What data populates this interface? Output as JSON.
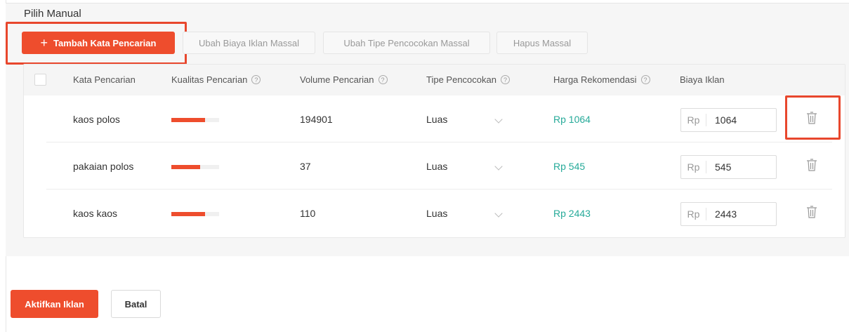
{
  "section": {
    "title": "Pilih Manual"
  },
  "toolbar": {
    "add_label": "Tambah Kata Pencarian",
    "add_icon": "plus-icon",
    "bulk_bid_label": "Ubah Biaya Iklan Massal",
    "bulk_match_label": "Ubah Tipe Pencocokan Massal",
    "bulk_delete_label": "Hapus Massal"
  },
  "table": {
    "headers": {
      "keyword": "Kata Pencarian",
      "quality": "Kualitas Pencarian",
      "volume": "Volume Pencarian",
      "match_type": "Tipe Pencocokan",
      "recommended_price": "Harga Rekomendasi",
      "bid": "Biaya Iklan"
    },
    "rows": [
      {
        "keyword": "kaos polos",
        "quality_level": 0.7,
        "volume": "194901",
        "match_type": "Luas",
        "recommended_price": "Rp 1064",
        "bid_prefix": "Rp",
        "bid_value": "1064"
      },
      {
        "keyword": "pakaian polos",
        "quality_level": 0.6,
        "volume": "37",
        "match_type": "Luas",
        "recommended_price": "Rp 545",
        "bid_prefix": "Rp",
        "bid_value": "545"
      },
      {
        "keyword": "kaos kaos",
        "quality_level": 0.7,
        "volume": "110",
        "match_type": "Luas",
        "recommended_price": "Rp 2443",
        "bid_prefix": "Rp",
        "bid_value": "2443"
      }
    ]
  },
  "footer": {
    "activate_label": "Aktifkan Iklan",
    "cancel_label": "Batal"
  },
  "colors": {
    "accent": "#ee4d2d",
    "price": "#26aa99",
    "highlight": "#e8472d"
  }
}
